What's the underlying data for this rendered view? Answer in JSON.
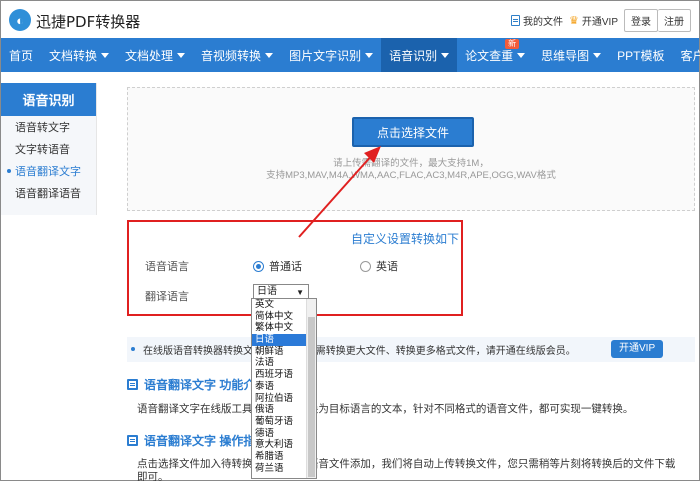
{
  "header": {
    "brand": "迅捷PDF转换器",
    "my_files": "我的文件",
    "vip": "开通VIP",
    "login": "登录",
    "register": "注册"
  },
  "nav": {
    "items": [
      {
        "label": "首页",
        "caret": false
      },
      {
        "label": "文档转换",
        "caret": true
      },
      {
        "label": "文档处理",
        "caret": true
      },
      {
        "label": "音视频转换",
        "caret": true
      },
      {
        "label": "图片文字识别",
        "caret": true
      },
      {
        "label": "语音识别",
        "caret": true,
        "active": true
      },
      {
        "label": "论文查重",
        "caret": true,
        "badge": "新"
      },
      {
        "label": "思维导图",
        "caret": true
      },
      {
        "label": "PPT模板",
        "caret": false
      },
      {
        "label": "客户端",
        "caret": true
      }
    ]
  },
  "sidebar": {
    "title": "语音识别",
    "items": [
      {
        "label": "语音转文字"
      },
      {
        "label": "文字转语音"
      },
      {
        "label": "语音翻译文字",
        "active": true
      },
      {
        "label": "语音翻译语音"
      }
    ]
  },
  "upload": {
    "button": "点击选择文件",
    "hint1": "请上传需翻译的文件，最大支持1M，",
    "hint2": "支持MP3,MAV,M4A,WMA,AAC,FLAC,AC3,M4R,APE,OGG,WAV格式"
  },
  "options": {
    "custom_link": "自定义设置转换如下",
    "speech_label": "语音语言",
    "speech_options": [
      "普通话",
      "英语"
    ],
    "speech_selected": "普通话",
    "translate_label": "翻译语言",
    "translate_selected": "日语",
    "translate_options": [
      "英文",
      "简体中文",
      "繁体中文",
      "日语",
      "朝鲜语",
      "法语",
      "西班牙语",
      "泰语",
      "阿拉伯语",
      "俄语",
      "葡萄牙语",
      "德语",
      "意大利语",
      "希腊语",
      "荷兰语"
    ]
  },
  "notice": {
    "text": "在线版语音转换器转换文件                   的文件，如需转换更大文件、转换更多格式文件，请开通在线版会员。",
    "vip_button": "开通VIP"
  },
  "sections": [
    {
      "title": "语音翻译文字 功能介绍",
      "text": "语音翻译文字在线版工具，                    音文件转换为目标语言的文本，针对不同格式的语音文件，都可实现一键转换。"
    },
    {
      "title": "语音翻译文字 操作指南",
      "text": "点击选择文件加入待转换的                   直接拖动语音文件添加，我们将自动上传转换文件，您只需稍等片刻将转换后的文件下载"
    },
    {
      "title": "",
      "text": "即可。"
    }
  ],
  "colors": {
    "primary": "#2b7dd1",
    "nav_active": "#1b62ad",
    "highlight": "#e02020"
  }
}
